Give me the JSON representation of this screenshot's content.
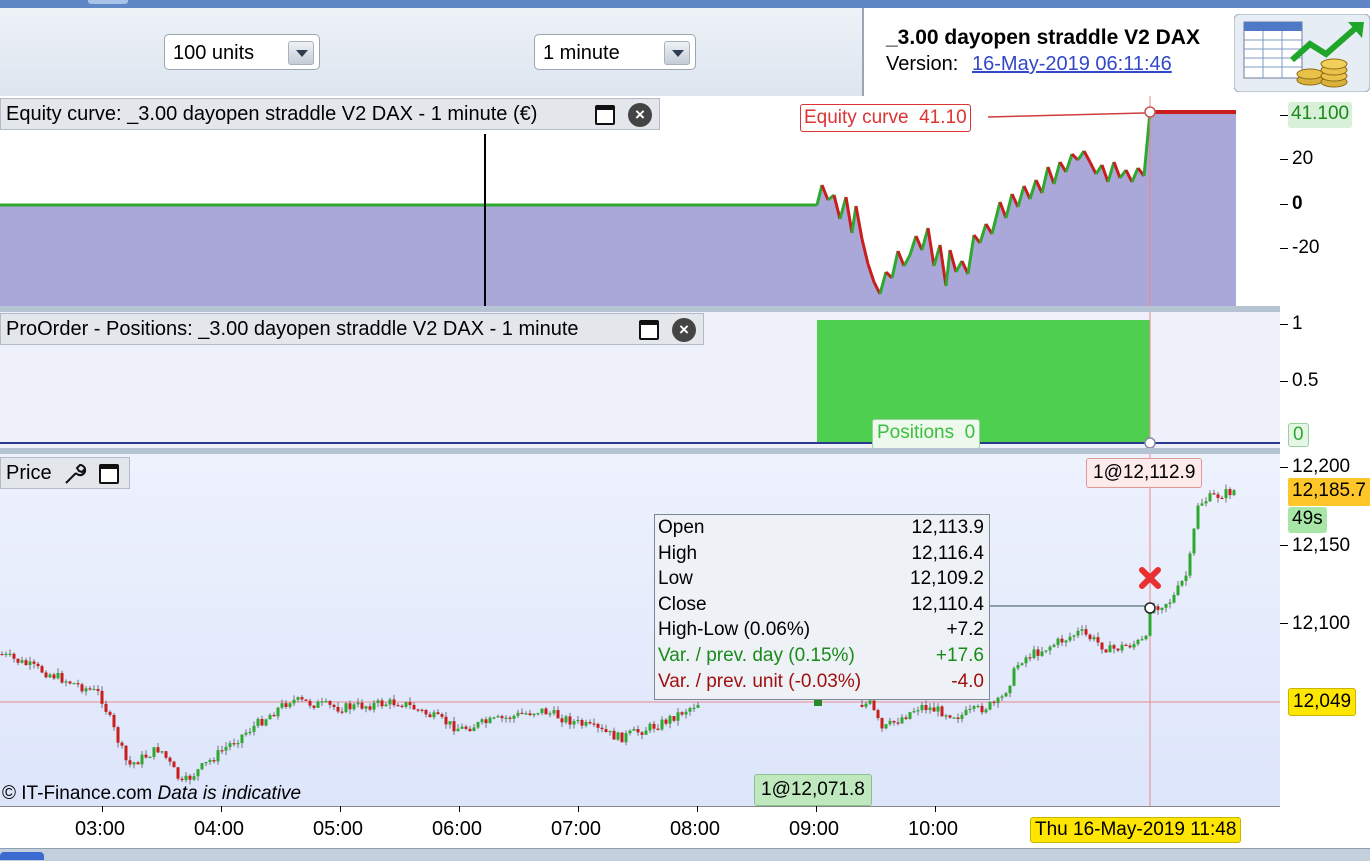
{
  "toolbar": {
    "units_select": "100 units",
    "timeframe_select": "1 minute"
  },
  "info": {
    "strategy_name": "_3.00 dayopen straddle V2 DAX",
    "version_label": "Version:",
    "version_date": "16-May-2019 06:11:46"
  },
  "equity_panel": {
    "title": "Equity curve: _3.00 dayopen straddle V2 DAX - 1 minute (€)",
    "label_name": "Equity curve",
    "label_value": "41.10",
    "last_value": "41.100",
    "y_ticks": [
      "20",
      "0",
      "-20"
    ]
  },
  "positions_panel": {
    "title": "ProOrder - Positions: _3.00 dayopen straddle V2 DAX - 1 minute",
    "label_name": "Positions",
    "label_value": "0",
    "last_value": "0",
    "y_ticks": [
      "1",
      "0.5"
    ]
  },
  "price_panel": {
    "title": "Price",
    "order_top": "1@12,112.9",
    "order_bottom": "1@12,071.8",
    "current_price": "12,185.7",
    "countdown": "49s",
    "hline_price": "12,049",
    "y_ticks": [
      "12,200",
      "12,150",
      "12,100"
    ],
    "copyright": "© IT-Finance.com",
    "disclaimer": "Data is indicative",
    "ohlc": [
      {
        "key": "Open",
        "value": "12,113.9",
        "color": "#000000"
      },
      {
        "key": "High",
        "value": "12,116.4",
        "color": "#000000"
      },
      {
        "key": "Low",
        "value": "12,109.2",
        "color": "#000000"
      },
      {
        "key": "Close",
        "value": "12,110.4",
        "color": "#000000"
      },
      {
        "key": "High-Low (0.06%)",
        "value": "+7.2",
        "color": "#000000"
      },
      {
        "key": "Var. / prev. day (0.15%)",
        "value": "+17.6",
        "color": "#1a8a1a"
      },
      {
        "key": "Var. / prev. unit (-0.03%)",
        "value": "-4.0",
        "color": "#a01010"
      }
    ]
  },
  "x_axis": {
    "labels": [
      "03:00",
      "04:00",
      "05:00",
      "06:00",
      "07:00",
      "08:00",
      "09:00",
      "10:00"
    ],
    "cursor_label": "Thu 16-May-2019 11:48"
  },
  "colors": {
    "equity_fill": "#aaa8d8",
    "up": "#2ea82e",
    "down": "#c81e1e",
    "positions_fill": "#4fcf4f",
    "cursor_line": "#e88888",
    "highlight_yellow": "#ffe600"
  }
}
